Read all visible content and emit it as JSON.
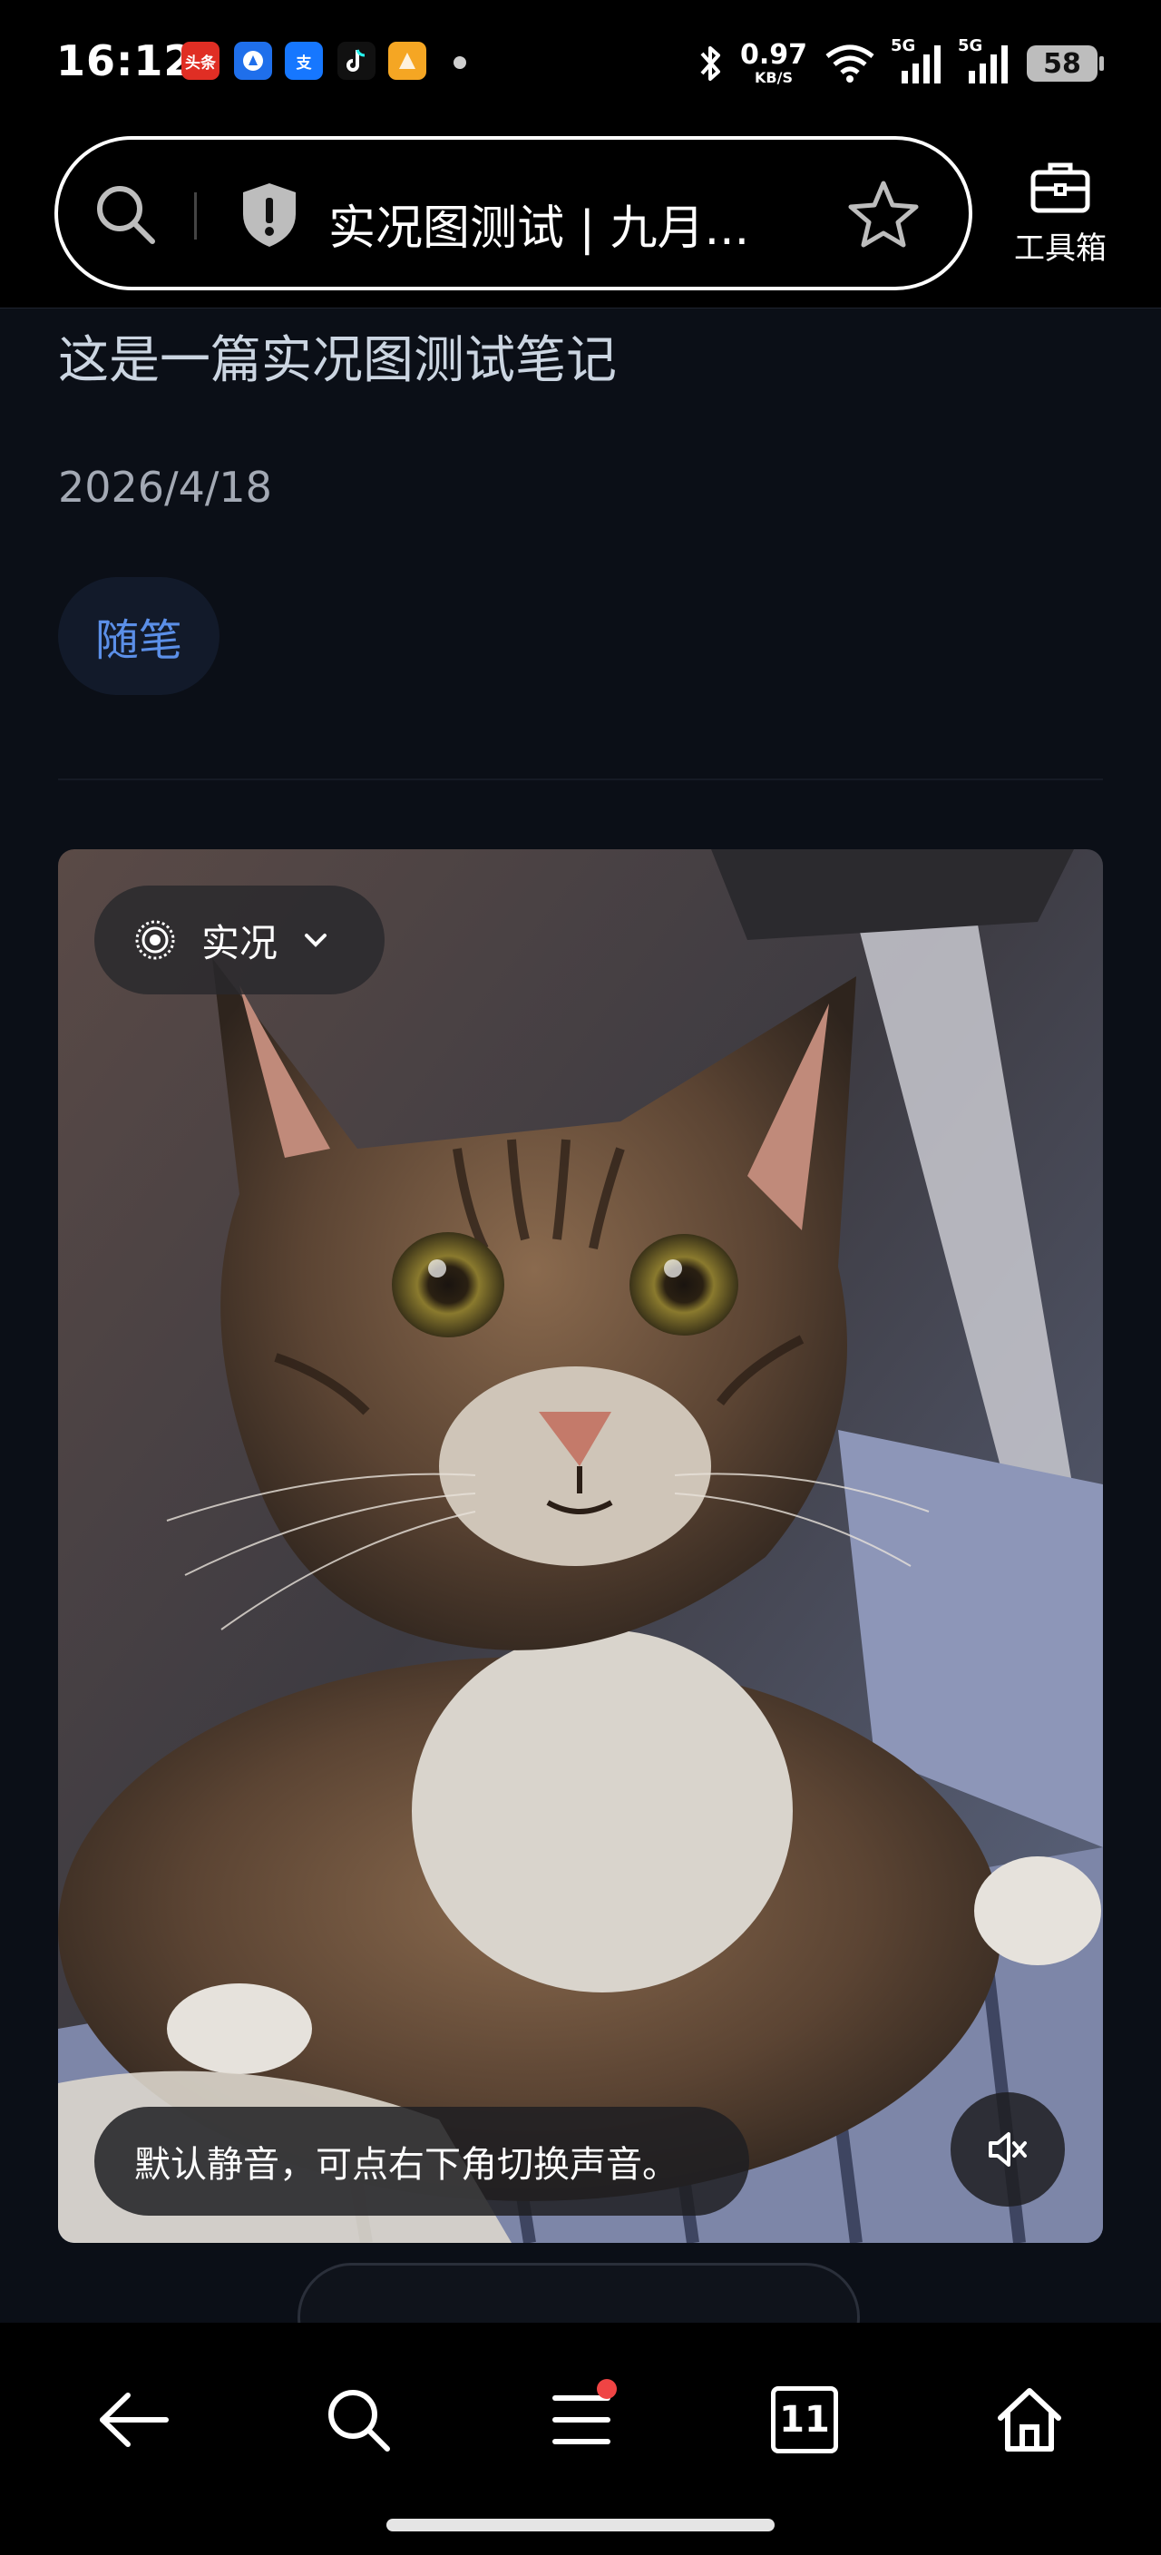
{
  "status_bar": {
    "time": "16:12",
    "notifications": [
      "头条",
      "",
      "支",
      "",
      ""
    ],
    "net_speed_value": "0.97",
    "net_speed_unit": "KB/S",
    "signal_1": "5G",
    "signal_2": "5G",
    "battery": "58"
  },
  "browser": {
    "page_title": "实况图测试 | 九月...",
    "toolbox_label": "工具箱"
  },
  "article": {
    "subtitle": "这是一篇实况图测试笔记",
    "date": "2026/4/18",
    "tag": "随笔"
  },
  "live_photo": {
    "badge_label": "实况",
    "mute_tip": "默认静音，可点右下角切换声音。"
  },
  "bottom_nav": {
    "tab_count": "11"
  },
  "colors": {
    "background": "#0b0f17",
    "tag_text": "#5b8fe8",
    "notification_dot": "#ef4444"
  }
}
